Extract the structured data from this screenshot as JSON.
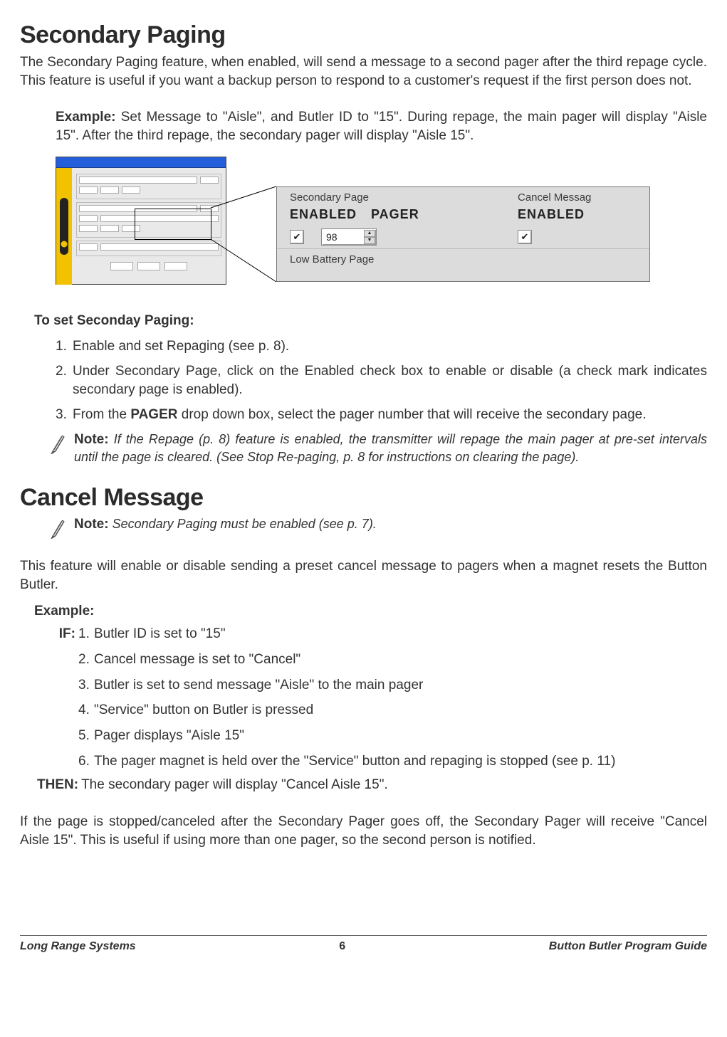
{
  "heading1": "Secondary Paging",
  "intro": "The Secondary Paging feature, when enabled, will send a message to a second pager after the third repage cycle. This feature is useful if you want a backup person to respond to a customer's request if the first per­son does not.",
  "example": {
    "label": "Example:",
    "text": "Set Message to \"Aisle\", and Butler ID to \"15\". During repage, the main pager will display \"Aisle 15\". After the third repage, the secondary pager will display \"Aisle 15\"."
  },
  "detail": {
    "secondary_page_label": "Secondary Page",
    "enabled_text": "ENABLED",
    "pager_text": "PAGER",
    "pager_value": "98",
    "cancel_label": "Cancel Messag",
    "cancel_enabled": "ENABLED",
    "low_battery_label": "Low Battery Page",
    "checkbox_checked": true
  },
  "to_set_heading": "To set Seconday Paging:",
  "steps": {
    "s1": "Enable and set Repaging (see p. 8).",
    "s2": "Under Secondary Page, click on the Enabled check box to enable or disable (a check mark indicates secondary page is enabled).",
    "s3_pre": "From the ",
    "s3_bold": "PAGER",
    "s3_post": " drop down box, select the pager number that will receive the secondary page."
  },
  "note1": {
    "label": "Note:",
    "text": "If the Repage (p. 8) feature is enabled, the transmitter will repage the main pager at pre-set intervals until the page is cleared. (See Stop Re-paging, p. 8 for instructions on clearing the page)."
  },
  "heading2": "Cancel Message",
  "note2": {
    "label": "Note:",
    "text": "Secondary Paging must be enabled (see p. 7)."
  },
  "cancel_intro": "This feature will enable or disable sending a preset cancel message to pagers when a magnet resets the But­ton Butler.",
  "example2_label": "Example:",
  "if_label": "IF:",
  "if_items": {
    "i1": "Butler ID is set to \"15\"",
    "i2": "Cancel message is set to \"Cancel\"",
    "i3": "Butler is set to send message \"Aisle\" to the main pager",
    "i4": "\"Service\" button on Butler is pressed",
    "i5": "Pager displays \"Aisle 15\"",
    "i6": "The pager magnet is held over the \"Service\" button and repaging is stopped (see p. 11)"
  },
  "then_label": "THEN:",
  "then_text": "The secondary pager will display \"Cancel Aisle 15\".",
  "closing": "If the page is stopped/canceled after the Secondary Pager goes off, the Secondary Pager will receive \"Can­cel Aisle 15\". This is useful if using more than one pager, so the second person is notified.",
  "footer": {
    "left": "Long Range Systems",
    "center": "6",
    "right": "Button Butler Program Guide"
  }
}
